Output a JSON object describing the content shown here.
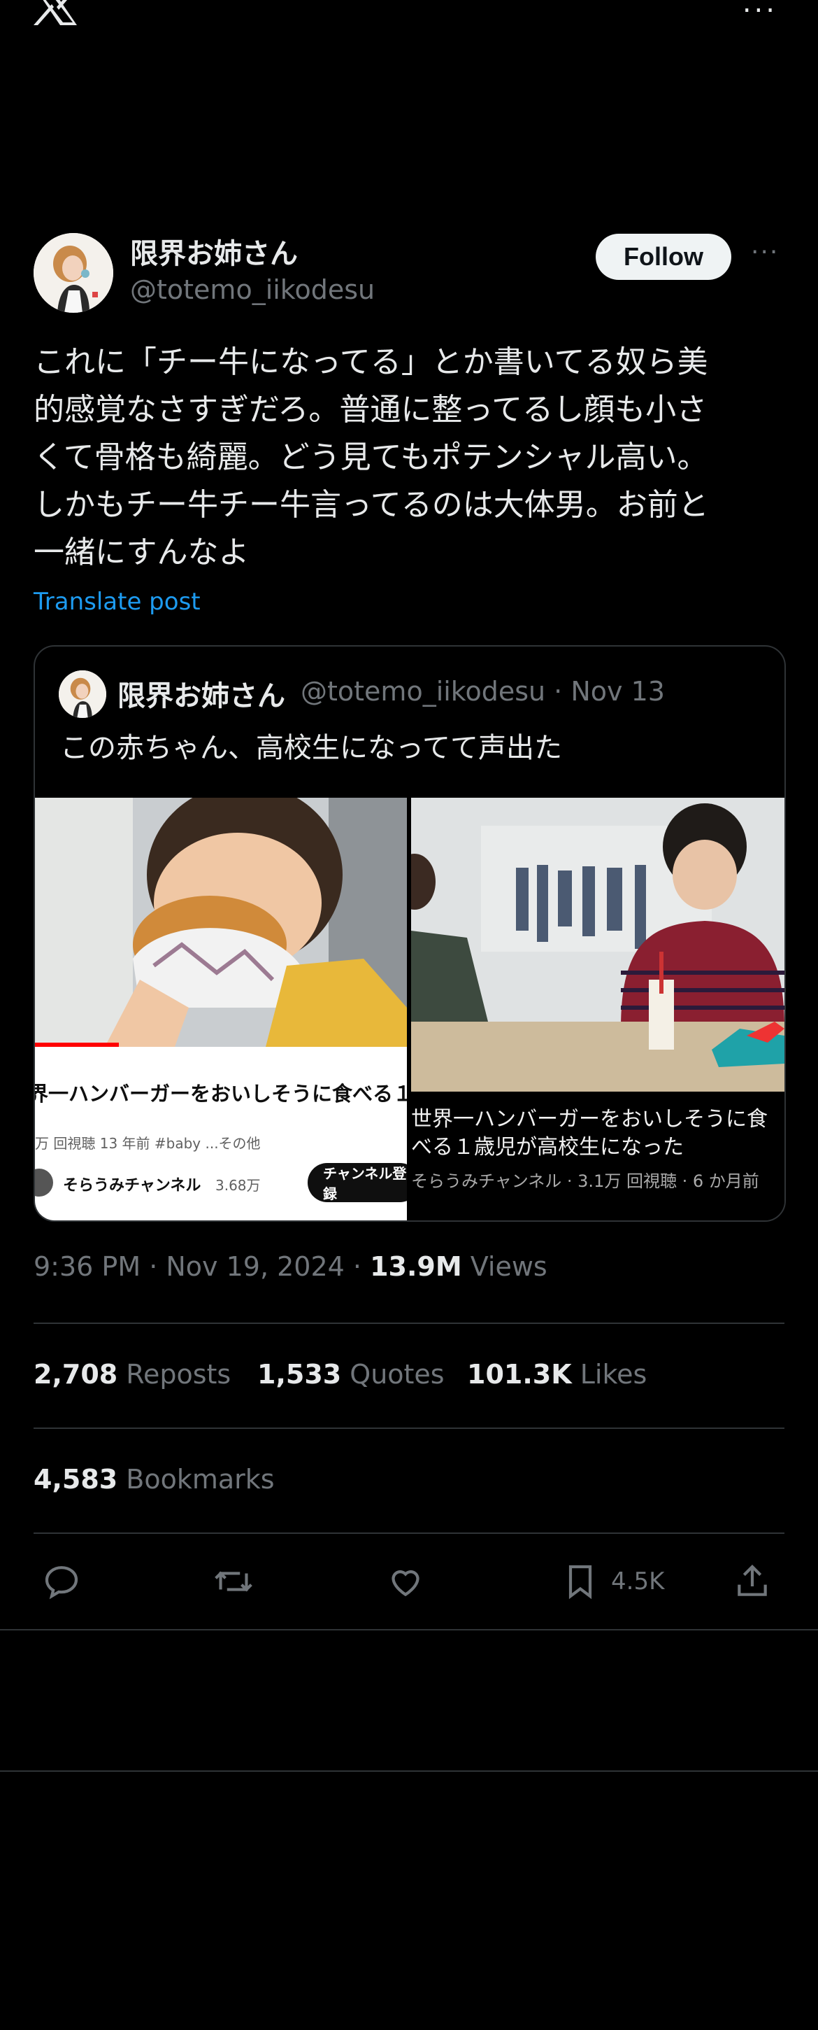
{
  "topbar": {
    "logo_icon": "x-logo-icon",
    "more_label": "..."
  },
  "author": {
    "name": "限界お姉さん",
    "handle": "@totemo_iikodesu",
    "follow_label": "Follow",
    "more_label": "···"
  },
  "tweet": {
    "text": "これに「チー牛になってる」とか書いてる奴ら美\n的感覚なさすぎだろ。普通に整ってるし顔も小さ\nくて骨格も綺麗。どう見てもポテンシャル高い。\nしかもチー牛チー牛言ってるのは大体男。お前と\n一緒にすんなよ",
    "translate_label": "Translate post"
  },
  "quote": {
    "name": "限界お姉さん",
    "handle_date": "@totemo_iikodesu · Nov 13",
    "text": "この赤ちゃん、高校生になってて声出た",
    "left_video": {
      "title": "界一ハンバーガーをおいしそうに食べる１",
      "meta": "万 回視聴  13 年前  #baby  ...その他",
      "channel": "そらうみチャンネル",
      "subs": "3.68万",
      "subscribe_label": "チャンネル登録"
    },
    "right_video": {
      "title": "世界一ハンバーガーをおいしそうに食べる１歳児が高校生になった",
      "meta": "そらうみチャンネル · 3.1万 回視聴 · 6 か月前"
    }
  },
  "meta": {
    "time_date": "9:36 PM · Nov 19, 2024 · ",
    "views_count": "13.9M",
    "views_label": " Views"
  },
  "stats": {
    "reposts_count": "2,708",
    "reposts_label": " Reposts",
    "quotes_count": "1,533",
    "quotes_label": " Quotes",
    "likes_count": "101.3K",
    "likes_label": " Likes",
    "bookmarks_count": "4,583",
    "bookmarks_label": " Bookmarks"
  },
  "actions": {
    "bookmark_count": "4.5K"
  },
  "colors": {
    "background": "#000000",
    "accent": "#1d9bf0",
    "muted": "#71767b",
    "divider": "#2f3336"
  }
}
